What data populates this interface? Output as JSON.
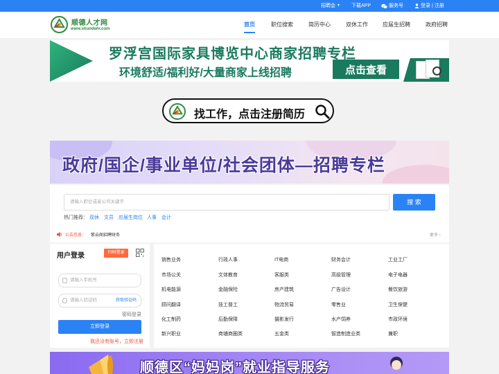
{
  "topbar": {
    "recruit_fair": "招聘会",
    "download_app": "下载APP",
    "service_account": "服务号",
    "login": "登录",
    "separator": "|",
    "register": "注册"
  },
  "header": {
    "logo_title": "顺德人才网",
    "logo_url": "www.shundehr.com",
    "nav": [
      "首页",
      "职位搜索",
      "简历中心",
      "双休工作",
      "应届生招聘",
      "政府招聘"
    ],
    "active_nav": "首页"
  },
  "banner1": {
    "line1": "罗浮宫国际家具博览中心商家招聘专栏",
    "line2": "环境舒适/福利好/大量商家上线招聘",
    "button": "点击查看",
    "colors": {
      "green": "#1a7a5e"
    }
  },
  "banner2": {
    "text": "找工作，点击注册简历"
  },
  "banner3": {
    "text": "政府/国企/事业单位/社会团体—招聘专栏"
  },
  "search": {
    "placeholder": "请输入职位或者公司关键字",
    "button": "搜 索",
    "hot_label": "热门推荐：",
    "hot": [
      "双休",
      "文员",
      "应届生岗位",
      "人事",
      "会计"
    ]
  },
  "notice": {
    "label": "公告信息：",
    "text": "紫云阁招聘财务",
    "more": "更多 ›"
  },
  "login": {
    "title": "用户登录",
    "badge": "扫码登录",
    "phone_placeholder": "请输入手机号",
    "code_placeholder": "请输入验证码",
    "get_code": "获取验证码",
    "password_login": "密码登录",
    "login_button": "立即登录",
    "register_prompt": "我还没有账号，立即注册"
  },
  "categories": [
    [
      "销售业务",
      "行政人事",
      "IT电商",
      "财务会计",
      "工业工厂"
    ],
    [
      "市场公关",
      "文体教育",
      "客服类",
      "高级管理",
      "电子电器"
    ],
    [
      "机电能源",
      "金融保险",
      "房产建筑",
      "广告设计",
      "餐饮旅游"
    ],
    [
      "顾问翻译",
      "技工普工",
      "物流贸易",
      "零售业",
      "卫生保健"
    ],
    [
      "化工制药",
      "后勤保障",
      "摄影发行",
      "水产饲养",
      "市政环境"
    ],
    [
      "新兴职业",
      "商铺商圈类",
      "五金类",
      "智造制造业类",
      "兼职"
    ]
  ],
  "banner4": {
    "text": "顺德区“妈妈岗”就业指导服务"
  },
  "colors": {
    "primary": "#2b82f5",
    "accent": "#ff6a3d",
    "logo_green": "#2e8b3e"
  }
}
